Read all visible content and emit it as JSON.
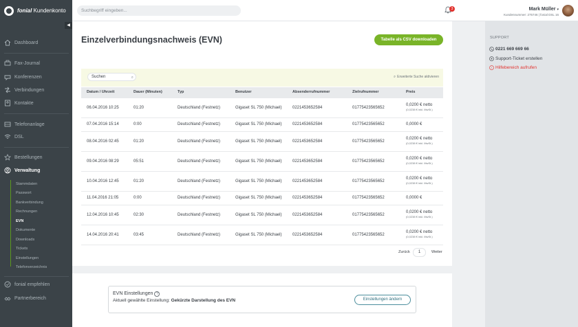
{
  "brand": {
    "name": "fonial",
    "suffix": "Kundenkonto"
  },
  "header": {
    "search_placeholder": "Suchbegriff eingeben...",
    "notification_count": "3",
    "user_name": "Mark Müller",
    "user_sub": "Kundennummer: 275746 | fonial DSL 16"
  },
  "sidebar": {
    "items": [
      {
        "label": "Dashboard",
        "icon": "home-icon"
      },
      {
        "label": "Fax-Journal",
        "icon": "fax-icon"
      },
      {
        "label": "Konferenzen",
        "icon": "conference-icon"
      },
      {
        "label": "Verbindungen",
        "icon": "connections-icon"
      },
      {
        "label": "Kontakte",
        "icon": "contacts-icon"
      },
      {
        "label": "Telefonanlage",
        "icon": "pbx-icon"
      },
      {
        "label": "DSL",
        "icon": "wifi-icon"
      },
      {
        "label": "Bestellungen",
        "icon": "star-icon"
      },
      {
        "label": "Verwaltung",
        "icon": "user-icon"
      },
      {
        "label": "fonial empfehlen",
        "icon": "recommend-icon"
      },
      {
        "label": "Partnerbereich",
        "icon": "partner-icon"
      }
    ],
    "subitems": [
      "Stammdaten",
      "Passwort",
      "Bankverbindung",
      "Rechnungen",
      "EVN",
      "Dokumente",
      "Downloads",
      "Tickets",
      "Einstellungen",
      "Telefonverzeichnis"
    ]
  },
  "main": {
    "title": "Einzelverbindungsnachweis (EVN)",
    "csv_button": "Tabelle als CSV downloaden",
    "table_search": "Suchen",
    "advanced_search": "Erweiterte Suche aktivieren",
    "columns": [
      "Datum / Uhrzeit",
      "Dauer (Minuten)",
      "Typ",
      "Benutzer",
      "Absenderrufnummer",
      "Zielrufnummer",
      "Preis"
    ],
    "rows": [
      {
        "date": "06.04.2016 10:25",
        "duration": "01:20",
        "type": "Deutschland (Festnetz)",
        "user": "Gigaset SL 750 (Michael)",
        "from": "0221453652584",
        "to": "01775423565652",
        "price": "0,0200 € netto",
        "price_gross": "(0,0238 € inkl. MwSt.)"
      },
      {
        "date": "07.04.2016 15:14",
        "duration": "0:00",
        "type": "Deutschland (Festnetz)",
        "user": "Gigaset SL 750 (Michael)",
        "from": "0221453652584",
        "to": "01775423565652",
        "price": "0,0000 €",
        "price_gross": ""
      },
      {
        "date": "08.04.2016 02:45",
        "duration": "01:20",
        "type": "Deutschland (Festnetz)",
        "user": "Gigaset SL 750 (Michael)",
        "from": "0221453652584",
        "to": "01775423565652",
        "price": "0,0200 € netto",
        "price_gross": "(0,0238 € inkl. MwSt.)"
      },
      {
        "date": "09.04.2016 08:29",
        "duration": "05:51",
        "type": "Deutschland (Festnetz)",
        "user": "Gigaset SL 750 (Michael)",
        "from": "0221453652584",
        "to": "01775423565652",
        "price": "0,0200 € netto",
        "price_gross": "(0,0238 € inkl. MwSt.)"
      },
      {
        "date": "10.04.2016 12:45",
        "duration": "01:20",
        "type": "Deutschland (Festnetz)",
        "user": "Gigaset SL 750 (Michael)",
        "from": "0221453652584",
        "to": "01775423565652",
        "price": "0,0200 € netto",
        "price_gross": "(0,0238 € inkl. MwSt.)"
      },
      {
        "date": "11.04.2016 21:05",
        "duration": "0:00",
        "type": "Deutschland (Festnetz)",
        "user": "Gigaset SL 750 (Michael)",
        "from": "0221453652584",
        "to": "01775423565652",
        "price": "0,0000 €",
        "price_gross": ""
      },
      {
        "date": "12.04.2016 10:45",
        "duration": "02:30",
        "type": "Deutschland (Festnetz)",
        "user": "Gigaset SL 750 (Michael)",
        "from": "0221453652584",
        "to": "01775423565652",
        "price": "0,0200 € netto",
        "price_gross": "(0,0238 € inkl. MwSt.)"
      },
      {
        "date": "14.04.2016 20:41",
        "duration": "03:45",
        "type": "Deutschland (Festnetz)",
        "user": "Gigaset SL 750 (Michael)",
        "from": "0221453652584",
        "to": "01775423565652",
        "price": "0,0200 € netto",
        "price_gross": "(0,0238 € inkl. MwSt.)"
      }
    ],
    "pager": {
      "back": "Zurück",
      "page": "1",
      "next": "Weiter"
    }
  },
  "settings": {
    "title": "EVN Einstellungen",
    "help": "?",
    "current_label": "Aktuell gewählte Einstellung:",
    "current_value": "Gekürzte Darstellung des EVN",
    "button": "Einstellungen ändern"
  },
  "support": {
    "heading": "SUPPORT",
    "phone": "0221 669 669 66",
    "ticket": "Support-Ticket erstellen",
    "help": "Hilfebereich aufrufen"
  },
  "colors": {
    "accent": "#79b428",
    "sidebar": "#3b4348",
    "alert": "#e2332f"
  }
}
